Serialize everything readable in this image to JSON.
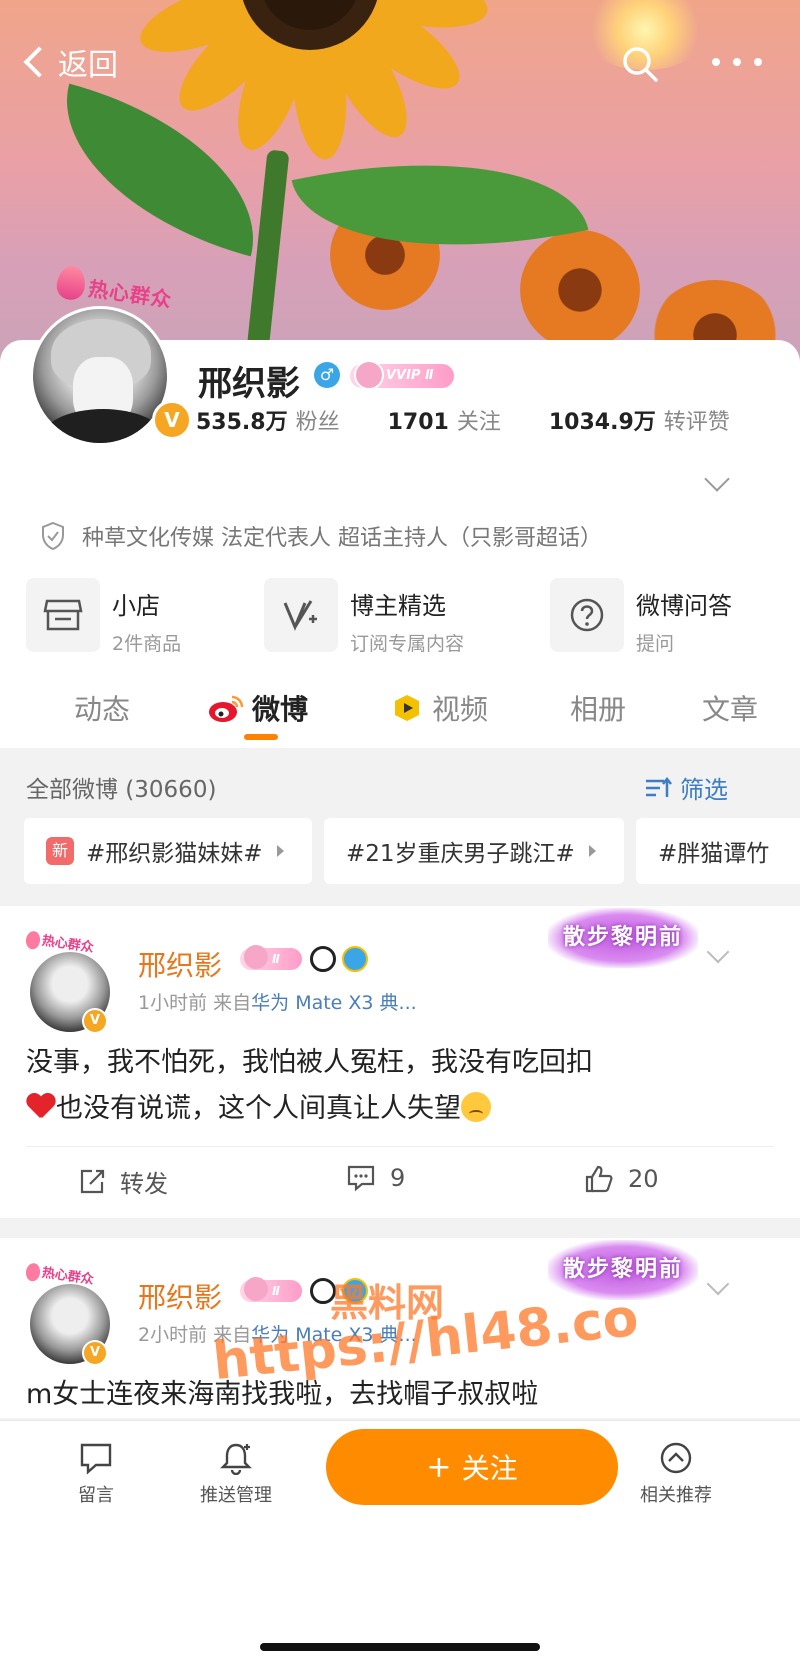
{
  "nav": {
    "back_label": "返回"
  },
  "profile": {
    "badge_text": "热心群众",
    "name": "邢织影",
    "gender_symbol": "♂",
    "vip_label": "VVIP Ⅱ",
    "verified_mark": "V",
    "stats": [
      {
        "value": "535.8万",
        "label": "粉丝"
      },
      {
        "value": "1701",
        "label": "关注"
      },
      {
        "value": "1034.9万",
        "label": "转评赞"
      }
    ],
    "verification": "种草文化传媒 法定代表人 超话主持人（只影哥超话）"
  },
  "services": [
    {
      "title": "小店",
      "subtitle": "2件商品",
      "icon": "store-icon"
    },
    {
      "title": "博主精选",
      "subtitle": "订阅专属内容",
      "icon": "v-plus-icon"
    },
    {
      "title": "微博问答",
      "subtitle": "提问",
      "icon": "question-icon"
    }
  ],
  "tabs": [
    "动态",
    "微博",
    "视频",
    "相册",
    "文章"
  ],
  "filter": {
    "title": "全部微博 (30660)",
    "filter_label": "筛选",
    "chips": [
      {
        "new": "新",
        "label": "#邢织影猫妹妹#"
      },
      {
        "label": "#21岁重庆男子跳江#"
      },
      {
        "label": "#胖猫谭竹"
      }
    ]
  },
  "posts": [
    {
      "name": "邢织影",
      "badge_text": "热心群众",
      "vip_level": "Ⅱ",
      "decor_text": "散步黎明前",
      "time": "1小时前",
      "source_prefix": "来自",
      "source": "华为 Mate X3 典...",
      "text_line1": "没事，我不怕死，我怕被人冤枉，我没有吃回扣",
      "text_line2": "也没有说谎，这个人间真让人失望",
      "repost_label": "转发",
      "comments": "9",
      "likes": "20"
    },
    {
      "name": "邢织影",
      "badge_text": "热心群众",
      "vip_level": "Ⅱ",
      "decor_text": "散步黎明前",
      "time": "2小时前",
      "source_prefix": "来自",
      "source": "华为 Mate X3 典...",
      "text_line1": "m女士连夜来海南找我啦，去找帽子叔叔啦"
    }
  ],
  "bottom": {
    "comment_label": "留言",
    "push_label": "推送管理",
    "follow_label": "关注",
    "follow_plus": "+",
    "recommend_label": "相关推荐"
  },
  "watermark": {
    "line1": "黑料网",
    "line2": "https://hl48.co"
  },
  "colors": {
    "accent": "#ff8c00",
    "link": "#4a7ebb",
    "name_orange": "#e8761b"
  }
}
